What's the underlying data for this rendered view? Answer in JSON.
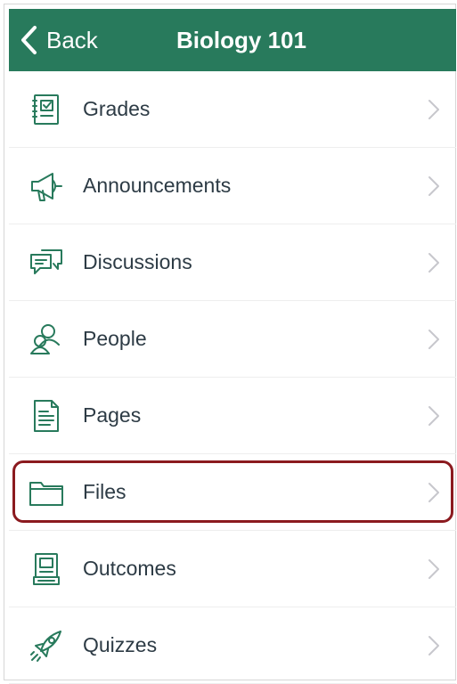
{
  "colors": {
    "nav_background": "#287a5c",
    "icon": "#287a5c",
    "highlight_border": "#8b1a1f",
    "chevron": "#c7c7cc",
    "text": "#2d3b45"
  },
  "navbar": {
    "back_label": "Back",
    "title": "Biology 101"
  },
  "menu": {
    "items": [
      {
        "label": "Grades",
        "icon": "gradebook-icon"
      },
      {
        "label": "Announcements",
        "icon": "megaphone-icon"
      },
      {
        "label": "Discussions",
        "icon": "chat-bubbles-icon"
      },
      {
        "label": "People",
        "icon": "people-icon"
      },
      {
        "label": "Pages",
        "icon": "document-icon"
      },
      {
        "label": "Files",
        "icon": "folder-icon",
        "highlighted": true
      },
      {
        "label": "Outcomes",
        "icon": "outcomes-icon"
      },
      {
        "label": "Quizzes",
        "icon": "rocket-icon"
      }
    ]
  }
}
